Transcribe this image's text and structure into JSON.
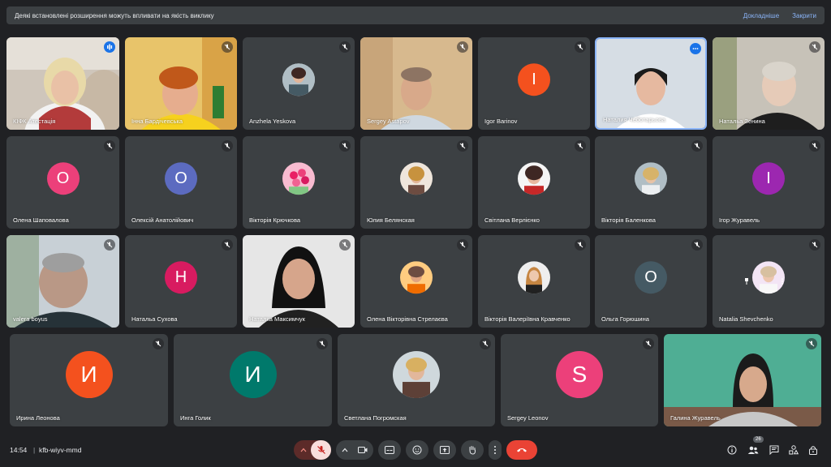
{
  "banner": {
    "message": "Деякі встановлені розширення можуть впливати на якість виклику",
    "details": "Докладніше",
    "close": "Закрити"
  },
  "participants": [
    {
      "name": "КІФК Атестація"
    },
    {
      "name": "Інна Бардічевська"
    },
    {
      "name": "Anzhela Yeskova"
    },
    {
      "name": "Sergey Astapov"
    },
    {
      "name": "Igor Barinov",
      "initial": "I"
    },
    {
      "name": "Наталия Чеботарьова"
    },
    {
      "name": "Натальа Зенина"
    },
    {
      "name": "Олена Шаповалова",
      "initial": "О"
    },
    {
      "name": "Олексій Анатолійович",
      "initial": "О"
    },
    {
      "name": "Вікторія Крючкова"
    },
    {
      "name": "Юлия Белянская"
    },
    {
      "name": "Світлана Верлієнко"
    },
    {
      "name": "Вікторія Баленкова"
    },
    {
      "name": "Ігор Журавель",
      "initial": "І"
    },
    {
      "name": "valera boyus"
    },
    {
      "name": "Натальа Сухова",
      "initial": "Н"
    },
    {
      "name": "Наталка Максимчук"
    },
    {
      "name": "Олена Вікторівна Стрелаєва"
    },
    {
      "name": "Вікторія Валеріївна Кравченко"
    },
    {
      "name": "Ольга Горюшина",
      "initial": "О"
    },
    {
      "name": "Natalia Shevchenko"
    },
    {
      "name": "Ирина Леонова",
      "initial": "И"
    },
    {
      "name": "Инга Голик",
      "initial": "И"
    },
    {
      "name": "Светлана Погромская"
    },
    {
      "name": "Sergey Leonov",
      "initial": "S"
    },
    {
      "name": "Галина Журавель"
    }
  ],
  "colors": {
    "orange": "#f4511e",
    "pink": "#e91e63",
    "indigo": "#5c6bc0",
    "purple": "#9c27b0",
    "teal": "#00796b",
    "slate": "#455a64",
    "red_hangup": "#ea4335"
  },
  "bottom": {
    "time": "14:54",
    "meeting_code": "kfb-wiyv-mmd",
    "participant_count": "26"
  },
  "icons": [
    "mic-off-icon",
    "camera-icon",
    "captions-icon",
    "emoji-icon",
    "present-icon",
    "raise-hand-icon",
    "more-icon",
    "hang-up-icon",
    "info-icon",
    "people-icon",
    "chat-icon",
    "activities-icon",
    "lock-icon"
  ]
}
